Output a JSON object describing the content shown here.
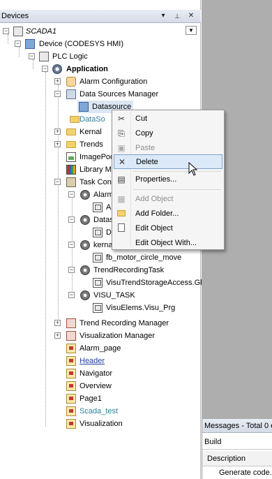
{
  "devices_panel": {
    "title": "Devices",
    "buttons": {
      "dropdown": "▾",
      "pin": "ᵖ",
      "close": "✕"
    }
  },
  "tree": {
    "root": "SCADA1",
    "device": "Device (CODESYS HMI)",
    "plc_logic": "PLC Logic",
    "application": "Application",
    "items": [
      "Alarm Configuration",
      "Data Sources Manager",
      "Datasource",
      "DataSo",
      "Kernal",
      "Trends",
      "ImagePoo",
      "Library Ma",
      "Task Confi",
      "Alarm",
      "A",
      "Datas",
      "D",
      "kerna",
      "fb_motor_circle_move",
      "TrendRecordingTask",
      "VisuTrendStorageAccess.Glo",
      "VISU_TASK",
      "VisuElems.Visu_Prg",
      "Trend Recording Manager",
      "Visualization Manager",
      "Alarm_page",
      "Header",
      "Navigator",
      "Overview",
      "Page1",
      "Scada_test",
      "Visualization"
    ]
  },
  "context_menu": {
    "items": [
      {
        "label": "Cut",
        "icon": "scissors-icon",
        "glyph": "✂",
        "enabled": true
      },
      {
        "label": "Copy",
        "icon": "copy-icon",
        "glyph": "⎘",
        "enabled": true
      },
      {
        "label": "Paste",
        "icon": "paste-icon",
        "glyph": "📋",
        "enabled": false
      },
      {
        "label": "Delete",
        "icon": "delete-icon",
        "glyph": "✕",
        "enabled": true
      },
      {
        "label": "Properties...",
        "icon": "properties-icon",
        "glyph": "▤",
        "enabled": true
      },
      {
        "label": "Add Object",
        "icon": "add-object-icon",
        "glyph": "▦",
        "enabled": false
      },
      {
        "label": "Add Folder...",
        "icon": "folder-icon",
        "glyph": "",
        "enabled": true
      },
      {
        "label": "Edit Object",
        "icon": "edit-object-icon",
        "glyph": "",
        "enabled": true
      },
      {
        "label": "Edit Object With...",
        "icon": "",
        "glyph": "",
        "enabled": true
      }
    ],
    "hovered": "Delete"
  },
  "messages": {
    "title": "Messages - Total 0 er",
    "build_label": "Build",
    "column_description": "Description",
    "row_text": "Generate code..."
  }
}
